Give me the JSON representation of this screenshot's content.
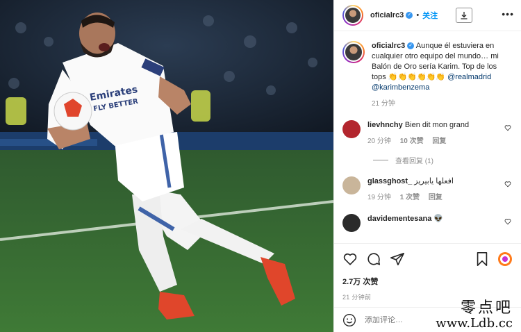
{
  "post": {
    "username": "oficialrc3",
    "verified_icon": "verified-badge-icon",
    "follow_label": "关注",
    "separator": "•",
    "more_label": "•••"
  },
  "caption": {
    "username": "oficialrc3",
    "text": " Aunque él estuviera en cualquier otro equipo del mundo… mi Balón de Oro sería Karim. Top de los tops ",
    "emoji": "👏👏👏👏👏👏",
    "mention1": "@realmadrid",
    "mention2": "@karimbenzema",
    "time": "21 分钟"
  },
  "comments": [
    {
      "username": "lievhnchy",
      "text": "Bien dit mon grand",
      "time": "20 分钟",
      "likes": "10 次赞",
      "reply": "回复",
      "view_replies": "查看回复 (1)",
      "avatar_color": "#b3262e"
    },
    {
      "username": "glassghost_",
      "text": "افعلها يابيريز",
      "time": "19 分钟",
      "likes": "1 次赞",
      "reply": "回复",
      "avatar_color": "#c9b59a"
    },
    {
      "username": "davidementesana",
      "text": "👽",
      "avatar_color": "#2b2b2b"
    }
  ],
  "actions": {
    "views": "2.7万 次赞",
    "posted_ago": "21 分钟前",
    "comment_placeholder": "添加评论…"
  },
  "watermark": {
    "line1": "零点吧",
    "line2": "www.Ldb.cc"
  },
  "colors": {
    "link": "#00376b",
    "follow": "#0095f6",
    "muted": "#8e8e8e"
  }
}
